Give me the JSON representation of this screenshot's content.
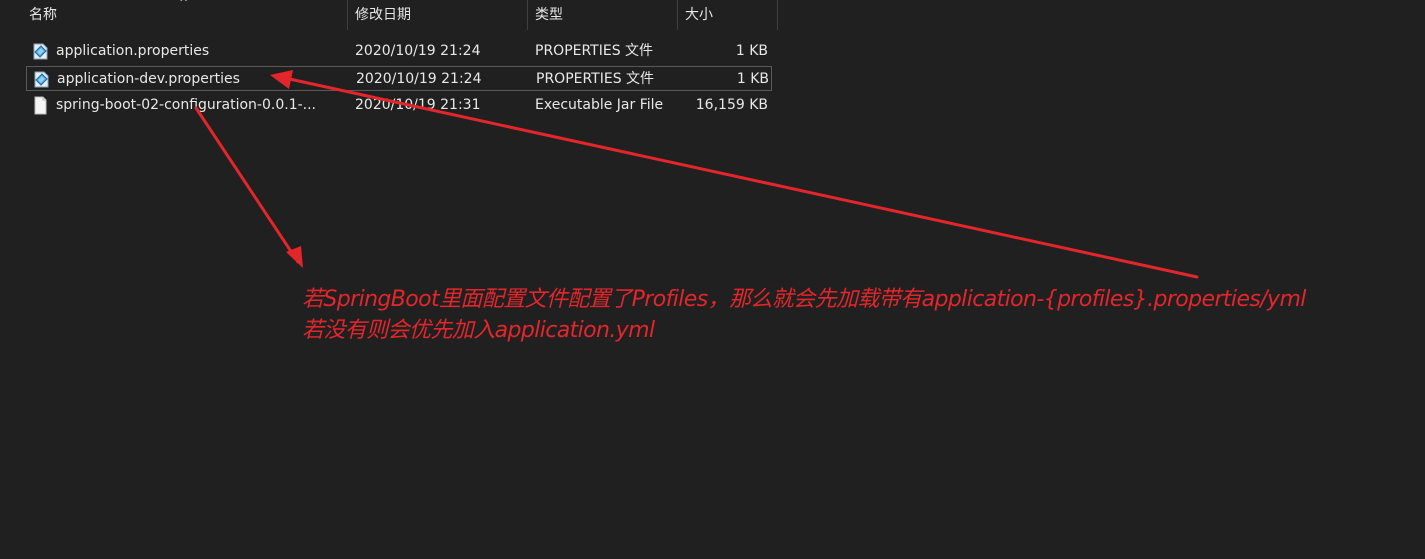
{
  "columns": {
    "name": "名称",
    "date": "修改日期",
    "type": "类型",
    "size": "大小"
  },
  "files": [
    {
      "name": "application.properties",
      "date": "2020/10/19 21:24",
      "type": "PROPERTIES 文件",
      "size": "1 KB",
      "icon": "properties-file-icon"
    },
    {
      "name": "application-dev.properties",
      "date": "2020/10/19 21:24",
      "type": "PROPERTIES 文件",
      "size": "1 KB",
      "icon": "properties-file-icon",
      "selected": true
    },
    {
      "name": "spring-boot-02-configuration-0.0.1-...",
      "date": "2020/10/19 21:31",
      "type": "Executable Jar File",
      "size": "16,159 KB",
      "icon": "blank-file-icon"
    }
  ],
  "annotation": {
    "line1": "若SpringBoot里面配置文件配置了Profiles，那么就会先加载带有application-{profiles}.properties/yml",
    "line2": "若没有则会优先加入application.yml",
    "color": "#e3262b"
  }
}
